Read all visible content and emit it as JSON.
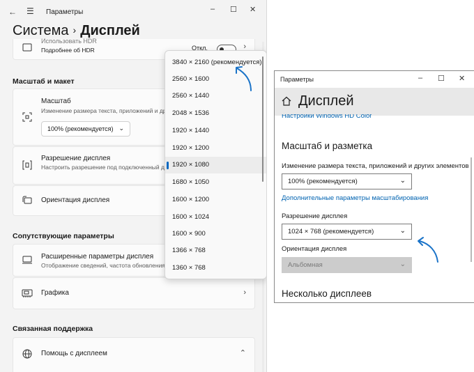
{
  "win11": {
    "title": "Параметры",
    "breadcrumb": {
      "parent": "Система",
      "separator": "›",
      "current": "Дисплей"
    },
    "controls": {
      "back": "←",
      "menu": "☰",
      "minimize": "–",
      "maximize": "☐",
      "close": "✕"
    },
    "hdr_row": {
      "title": "Использовать HDR",
      "sub": "Подробнее об HDR",
      "toggle_label": "Откл.",
      "chevron": "›"
    },
    "section_scale": "Масштаб и макет",
    "scale_row": {
      "title": "Масштаб",
      "sub": "Изменение размера текста, приложений и других элементов",
      "select_value": "100% (рекомендуется)",
      "dropdown_glyph": "⌄"
    },
    "resolution_row": {
      "title": "Разрешение дисплея",
      "sub": "Настроить разрешение под подключенный дисплей"
    },
    "orientation_row": {
      "title": "Ориентация дисплея"
    },
    "section_related": "Сопутствующие параметры",
    "advanced_row": {
      "title": "Расширенные параметры дисплея",
      "sub": "Отображение сведений, частота обновления"
    },
    "graphics_row": {
      "title": "Графика",
      "chevron": "›"
    },
    "section_support": "Связанная поддержка",
    "help_row": {
      "title": "Помощь с дисплеем",
      "chevron": "⌃"
    },
    "resolution_options": [
      "3840 × 2160 (рекомендуется)",
      "2560 × 1600",
      "2560 × 1440",
      "2048 × 1536",
      "1920 × 1440",
      "1920 × 1200",
      "1920 × 1080",
      "1680 × 1050",
      "1600 × 1200",
      "1600 × 1024",
      "1600 × 900",
      "1366 × 768",
      "1360 × 768"
    ],
    "selected_resolution": "1920 × 1080"
  },
  "win10": {
    "title": "Параметры",
    "controls": {
      "minimize": "–",
      "maximize": "☐",
      "close": "✕"
    },
    "heading": "Дисплей",
    "hdr_link": "Настройки Windows HD Color",
    "section_scale": "Масштаб и разметка",
    "scale_label": "Изменение размера текста, приложений и других элементов",
    "scale_value": "100% (рекомендуется)",
    "advanced_scale_link": "Дополнительные параметры масштабирования",
    "resolution_label": "Разрешение дисплея",
    "resolution_value": "1024 × 768 (рекомендуется)",
    "orientation_label": "Ориентация дисплея",
    "orientation_value": "Альбомная",
    "section_multi": "Несколько дисплеев",
    "dropdown_glyph": "⌄"
  },
  "colors": {
    "accent": "#0067c0",
    "arrow": "#1a73c8",
    "link": "#0063b1"
  }
}
